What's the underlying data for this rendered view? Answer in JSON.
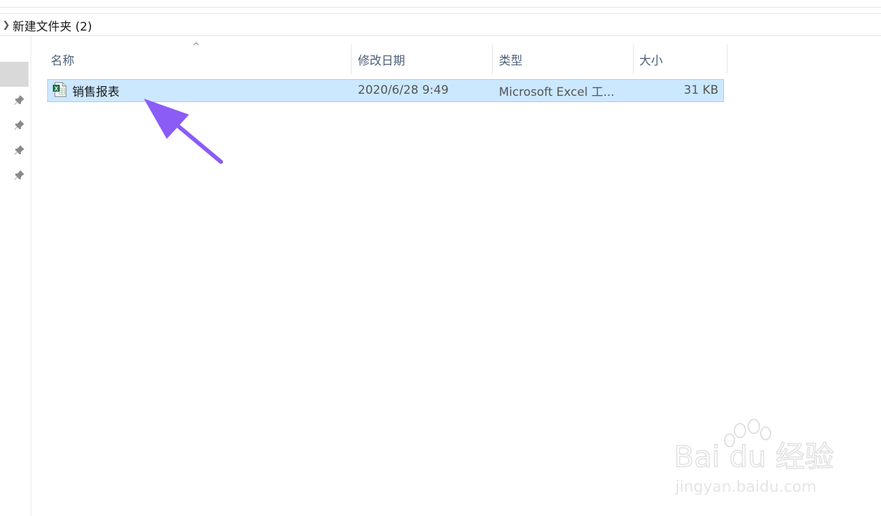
{
  "breadcrumb": {
    "folder_name": "新建文件夹 (2)"
  },
  "columns": {
    "name": "名称",
    "modified": "修改日期",
    "type": "类型",
    "size": "大小"
  },
  "files": [
    {
      "name": "销售报表",
      "modified": "2020/6/28 9:49",
      "type": "Microsoft Excel 工...",
      "size": "31 KB",
      "icon": "excel-file-icon",
      "selected": true
    }
  ],
  "nav": {
    "pinned_count": 4
  },
  "annotation": {
    "arrow_color": "#8b5cf6"
  },
  "watermark": {
    "brand": "Bai du 经验",
    "url": "jingyan.baidu.com"
  },
  "colors": {
    "selection_bg": "#cce8ff",
    "selection_border": "#99d1ff",
    "header_text": "#4c607a"
  }
}
